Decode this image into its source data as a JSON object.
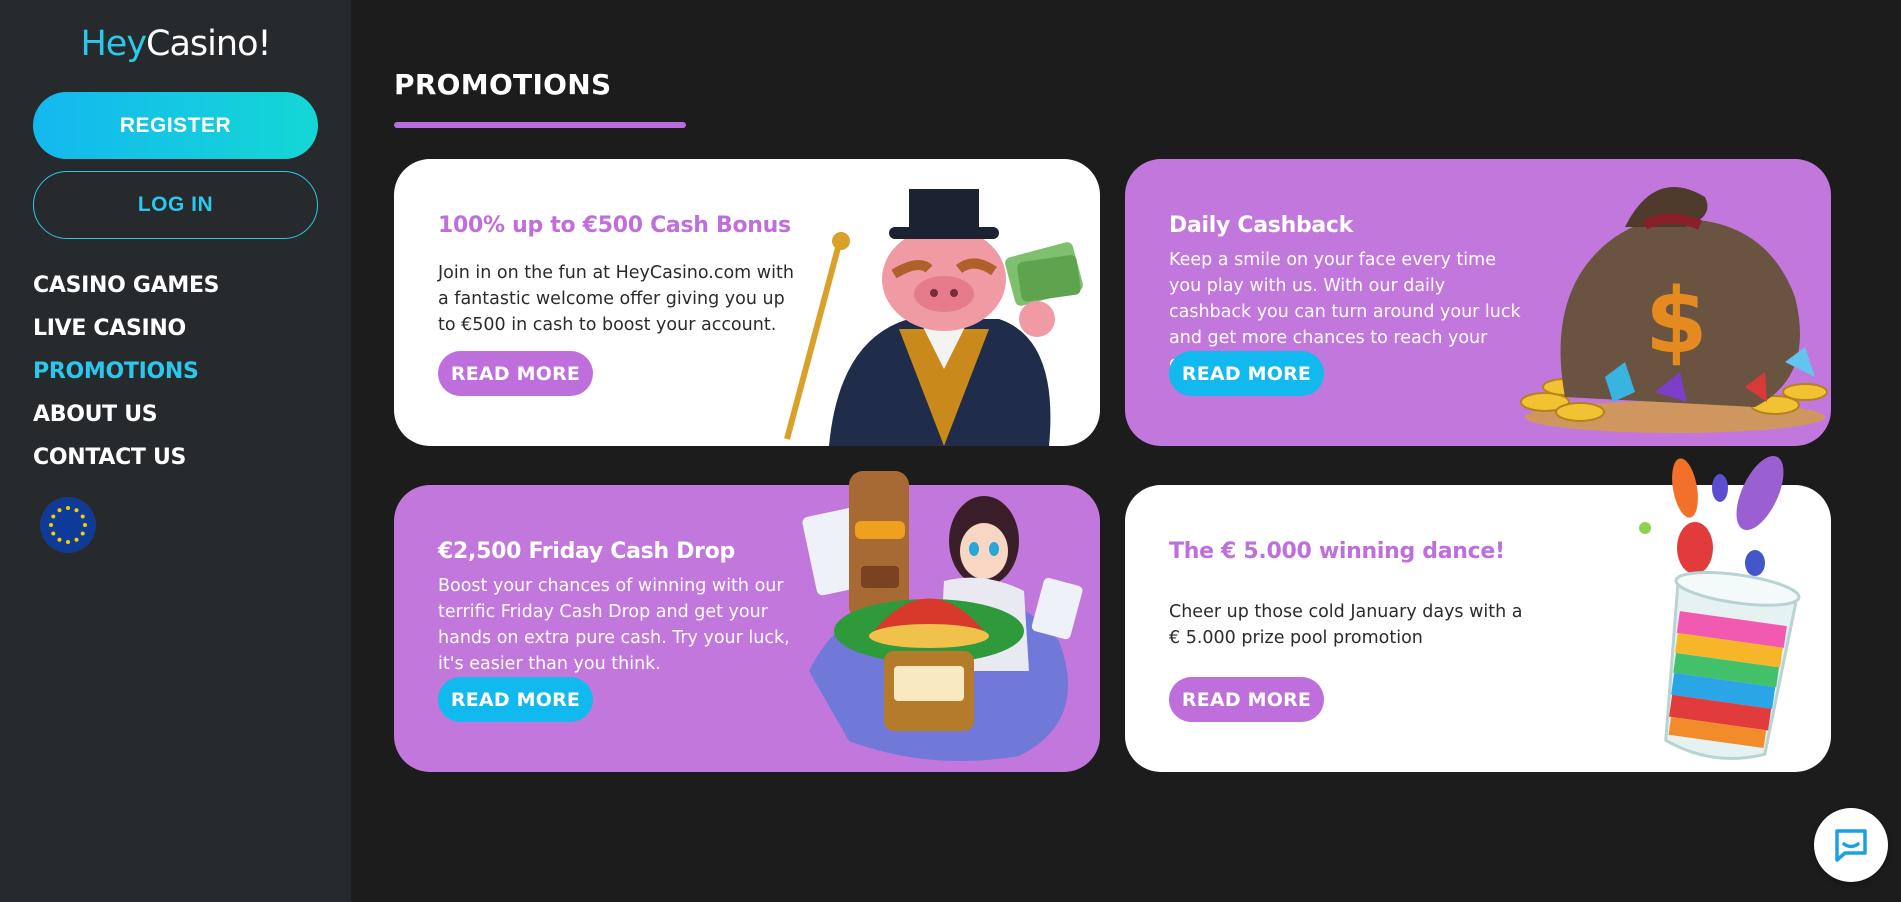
{
  "brand": {
    "logo_hey": "Hey",
    "logo_casino": "Casino!"
  },
  "sidebar": {
    "register_label": "REGISTER",
    "login_label": "LOG IN",
    "nav": [
      {
        "label": "CASINO GAMES",
        "active": false
      },
      {
        "label": "LIVE CASINO",
        "active": false
      },
      {
        "label": "PROMOTIONS",
        "active": true
      },
      {
        "label": "ABOUT US",
        "active": false
      },
      {
        "label": "CONTACT US",
        "active": false
      }
    ],
    "language_icon": "eu-flag-icon"
  },
  "main": {
    "title": "PROMOTIONS",
    "promos": [
      {
        "title": "100% up to €500 Cash Bonus",
        "description": "Join in on the fun at HeyCasino.com with a fantastic welcome offer giving you up to €500 in cash to boost your account.",
        "button": "READ MORE",
        "theme": "white",
        "art_icon": "pig-mascot-icon"
      },
      {
        "title": "Daily Cashback",
        "description": "Keep a smile on your face every time you play with us. With our daily cashback you can turn around your luck and get more chances to reach your goals.",
        "button": "READ MORE",
        "theme": "purple",
        "art_icon": "money-bag-icon"
      },
      {
        "title": "€2,500 Friday Cash Drop",
        "description": "Boost your chances of winning with our terrific Friday Cash Drop and get your hands on extra pure cash. Try your luck, it's easier than you think.",
        "button": "READ MORE",
        "theme": "purple",
        "art_icon": "tiki-anime-slot-icon"
      },
      {
        "title": "The € 5.000 winning dance!",
        "description": "Cheer up those cold January days with a € 5.000 prize pool promotion",
        "button": "READ MORE",
        "theme": "white",
        "art_icon": "candy-jar-icon"
      }
    ]
  },
  "colors": {
    "accent_cyan": "#2bc7ec",
    "accent_purple": "#bf6fdc",
    "card_purple": "#c277dc",
    "sidebar_bg": "#262a2d",
    "page_bg": "#1c1c1c"
  },
  "chat_icon": "chat-bubble-icon"
}
